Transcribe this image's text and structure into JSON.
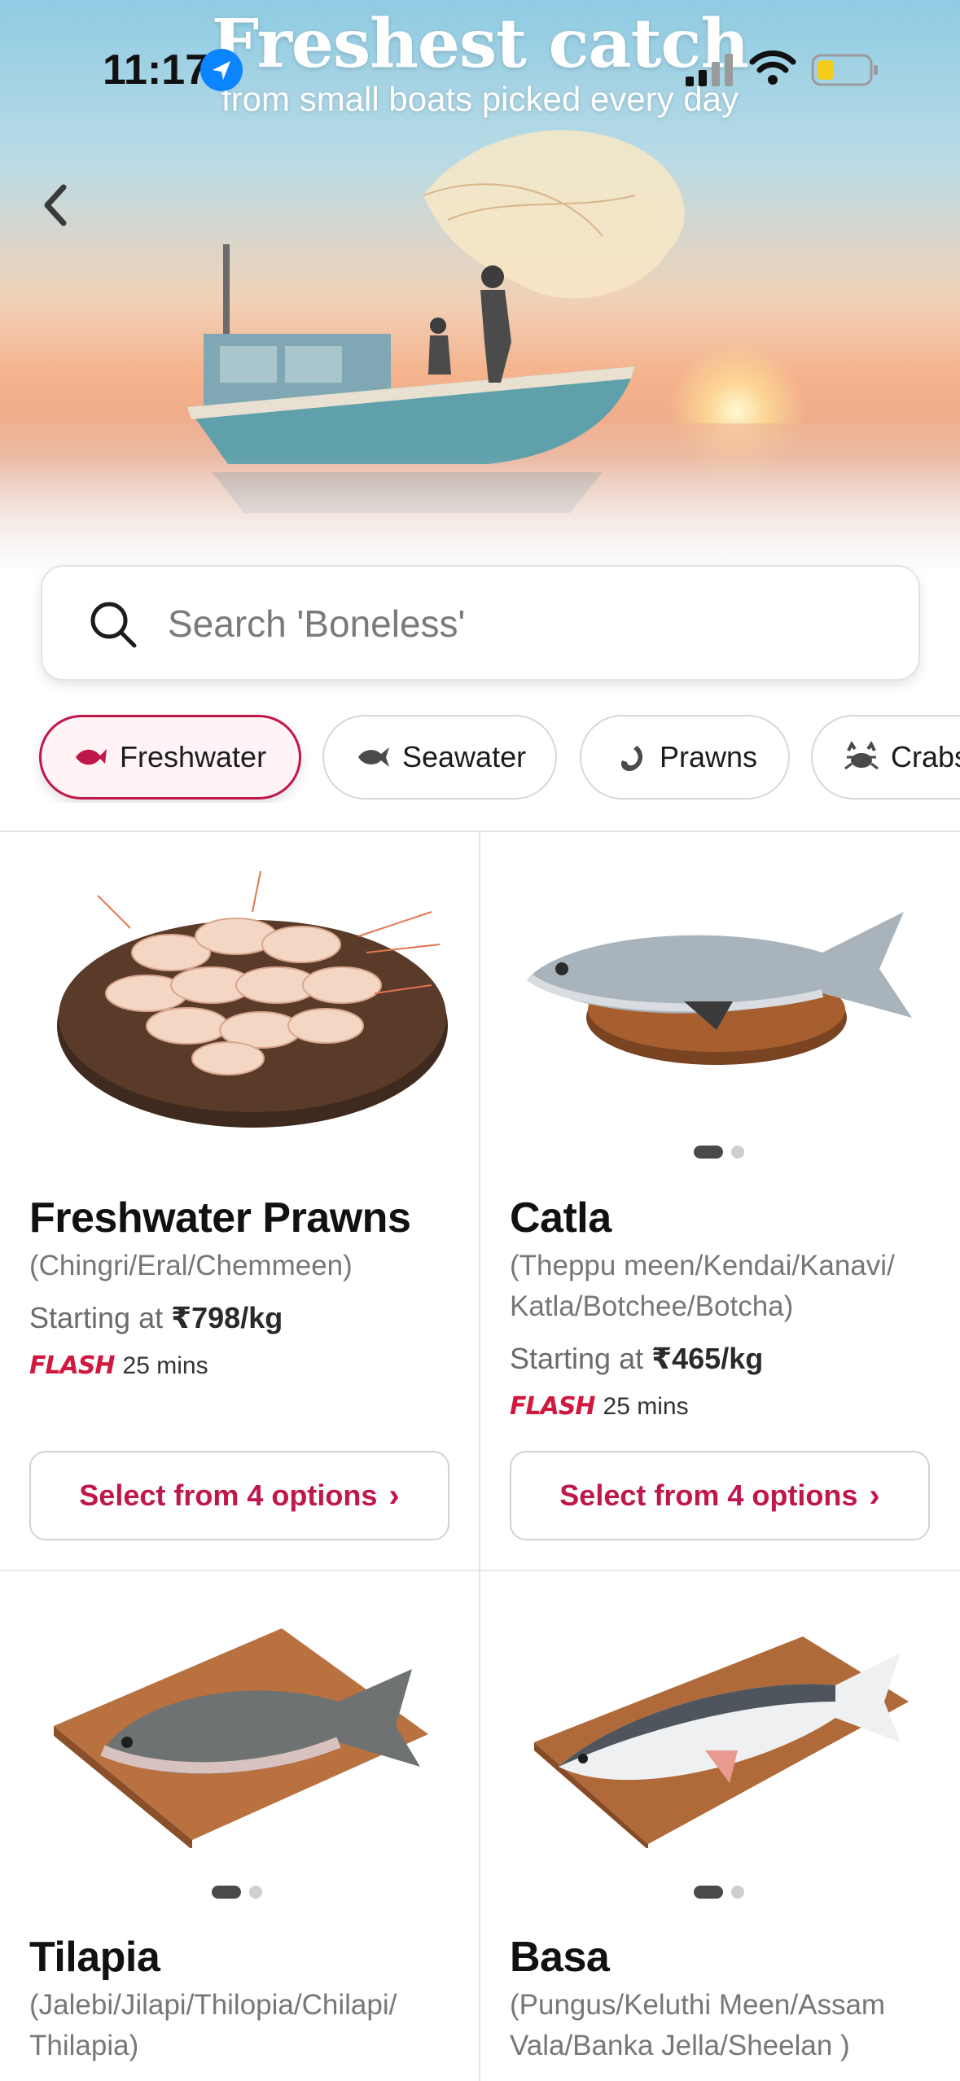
{
  "status_bar": {
    "time": "11:17"
  },
  "hero": {
    "title": "Freshest catch",
    "subtitle": "from small boats picked every day"
  },
  "search": {
    "placeholder": "Search 'Boneless'"
  },
  "categories": [
    {
      "label": "Freshwater",
      "icon": "fish-icon",
      "active": true
    },
    {
      "label": "Seawater",
      "icon": "sea-fish-icon",
      "active": false
    },
    {
      "label": "Prawns",
      "icon": "prawn-icon",
      "active": false
    },
    {
      "label": "Crabs",
      "icon": "crab-icon",
      "active": false
    }
  ],
  "products": [
    {
      "name": "Freshwater Prawns",
      "alias": "(Chingri/Eral/Chemmeen)",
      "price_prefix": "Starting at",
      "price": "₹798/kg",
      "flash": "FLASH",
      "delivery": "25 mins",
      "cta": "Select from 4 options"
    },
    {
      "name": "Catla",
      "alias": "(Theppu meen/Kendai/Kanavi/ Katla/Botchee/Botcha)",
      "price_prefix": "Starting at",
      "price": "₹465/kg",
      "flash": "FLASH",
      "delivery": "25 mins",
      "cta": "Select from 4 options"
    },
    {
      "name": "Tilapia",
      "alias": "(Jalebi/Jilapi/Thilopia/Chilapi/ Thilapia)"
    },
    {
      "name": "Basa",
      "alias": "(Pungus/Keluthi Meen/Assam Vala/Banka Jella/Sheelan )"
    }
  ],
  "colors": {
    "brand": "#c0174a",
    "flash": "#d1183f"
  }
}
